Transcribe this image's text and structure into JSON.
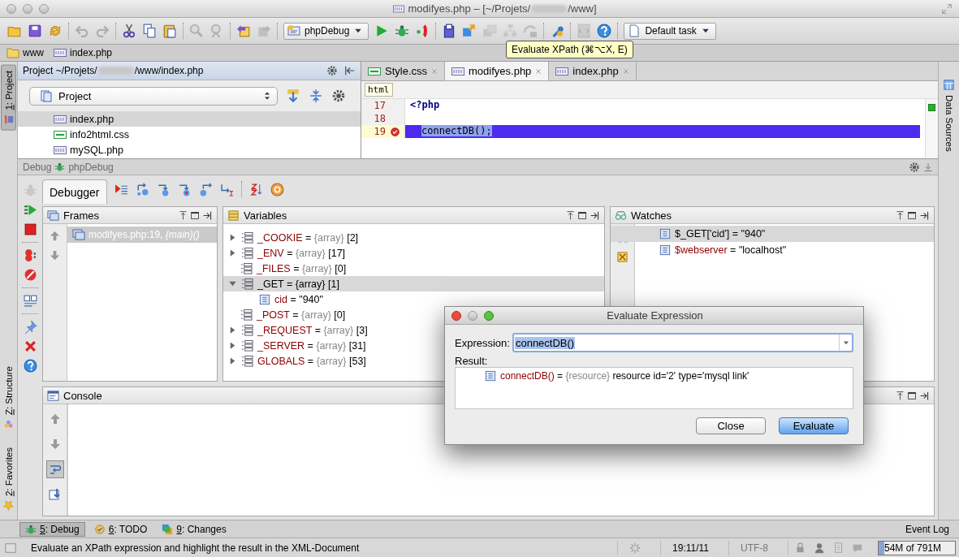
{
  "window": {
    "title_start": "modifyes.php – [~/Projets/",
    "title_end": "/www]"
  },
  "toolbar": {
    "groups": [
      {
        "items": [
          {
            "kind": "open",
            "disabled": false
          },
          {
            "kind": "save",
            "disabled": false
          },
          {
            "kind": "sync",
            "disabled": false
          }
        ]
      },
      {
        "items": [
          {
            "kind": "undo",
            "disabled": true
          },
          {
            "kind": "redo",
            "disabled": true
          }
        ]
      },
      {
        "items": [
          {
            "kind": "cut",
            "disabled": false
          },
          {
            "kind": "copy",
            "disabled": false
          },
          {
            "kind": "paste",
            "disabled": false
          }
        ]
      },
      {
        "items": [
          {
            "kind": "find",
            "disabled": true
          },
          {
            "kind": "replace",
            "disabled": true
          }
        ]
      },
      {
        "items": [
          {
            "kind": "back",
            "disabled": false
          },
          {
            "kind": "forward",
            "disabled": true
          }
        ]
      },
      {
        "items": [
          {
            "kind": "config",
            "label": "phpDebug",
            "disabled": false
          },
          {
            "kind": "run",
            "disabled": false
          },
          {
            "kind": "debug",
            "disabled": false
          },
          {
            "kind": "listen",
            "disabled": false
          }
        ]
      },
      {
        "items": [
          {
            "kind": "deploy",
            "disabled": false
          },
          {
            "kind": "upload",
            "disabled": false
          },
          {
            "kind": "layers",
            "disabled": true
          },
          {
            "kind": "tree",
            "disabled": true
          },
          {
            "kind": "rollback",
            "disabled": true
          }
        ]
      },
      {
        "items": [
          {
            "kind": "wrench",
            "disabled": false
          }
        ]
      },
      {
        "items": [
          {
            "kind": "xpath",
            "disabled": true
          },
          {
            "kind": "help",
            "disabled": false
          }
        ]
      },
      {
        "items": [
          {
            "kind": "task",
            "label": "Default task",
            "disabled": false
          }
        ]
      }
    ]
  },
  "tooltip": {
    "text": "Evaluate XPath (⌘⌥X, E)"
  },
  "breadcrumb": [
    {
      "label": "www",
      "kind": "folder"
    },
    {
      "label": "index.php",
      "kind": "php"
    }
  ],
  "left_stripe": [
    {
      "key": "1",
      "label": ": Project",
      "selected": true
    },
    {
      "key": "Z",
      "label": ": Structure",
      "selected": false
    },
    {
      "key": "2",
      "label": ": Favorites",
      "selected": false
    }
  ],
  "right_stripe": [
    {
      "label": "Data Sources",
      "selected": false
    }
  ],
  "project": {
    "header_start": "Project ~/Projets/",
    "header_end": "/www/index.php",
    "view": "Project",
    "files": [
      {
        "name": "index.php",
        "kind": "php",
        "selected": true
      },
      {
        "name": "info2html.css",
        "kind": "css",
        "selected": false
      },
      {
        "name": "mySQL.php",
        "kind": "php",
        "selected": false
      }
    ]
  },
  "editor": {
    "tabs": [
      {
        "label": "Style.css",
        "kind": "css",
        "selected": false
      },
      {
        "label": "modifyes.php",
        "kind": "php",
        "selected": true
      },
      {
        "label": "index.php",
        "kind": "php",
        "selected": false
      }
    ],
    "breadcrumb": "html",
    "lines": [
      {
        "number": "17",
        "code": "<?php",
        "kind": "keyword",
        "breakpoint": false,
        "current": false
      },
      {
        "number": "18",
        "kind": "plain",
        "breakpoint": false,
        "current": false
      },
      {
        "number": "19",
        "code": "connectDB();",
        "kind": "plain",
        "breakpoint": true,
        "current": true
      }
    ]
  },
  "debug": {
    "title": "Debug",
    "config": "phpDebug",
    "tabs": [
      {
        "label": "Debugger",
        "selected": true
      }
    ],
    "frames": {
      "title": "Frames",
      "items": [
        {
          "location": "modifyes.php:19, ",
          "function": "{main}()",
          "selected": true
        }
      ]
    },
    "variables": {
      "title": "Variables",
      "items": [
        {
          "name": "_COOKIE",
          "operator": "=",
          "type": "{array}",
          "value": "[2]",
          "kind": "node",
          "expanded": false,
          "selected": false
        },
        {
          "name": "_ENV",
          "operator": "=",
          "type": "{array}",
          "value": "[17]",
          "kind": "node",
          "expanded": false,
          "selected": false
        },
        {
          "name": "_FILES",
          "operator": "=",
          "type": "{array}",
          "value": "[0]",
          "kind": "empty",
          "expanded": false,
          "selected": false
        },
        {
          "name": "_GET",
          "operator": "=",
          "type": "{array}",
          "value": "[1]",
          "kind": "node",
          "expanded": true,
          "selected": true,
          "children": [
            {
              "name": "cid",
              "operator": "=",
              "value": "\"940\""
            }
          ]
        },
        {
          "name": "_POST",
          "operator": "=",
          "type": "{array}",
          "value": "[0]",
          "kind": "empty",
          "expanded": false,
          "selected": false
        },
        {
          "name": "_REQUEST",
          "operator": "=",
          "type": "{array}",
          "value": "[3]",
          "kind": "node",
          "expanded": false,
          "selected": false
        },
        {
          "name": "_SERVER",
          "operator": "=",
          "type": "{array}",
          "value": "[31]",
          "kind": "node",
          "expanded": false,
          "selected": false
        },
        {
          "name": "GLOBALS",
          "operator": "=",
          "type": "{array}",
          "value": "[53]",
          "kind": "node",
          "expanded": false,
          "selected": false
        }
      ]
    },
    "watches": {
      "title": "Watches",
      "items": [
        {
          "expression": "$_GET['cid']",
          "operator": "=",
          "value": "\"940\"",
          "selected": true
        },
        {
          "expression": "$webserver",
          "operator": "=",
          "value": "\"localhost\"",
          "selected": false
        }
      ]
    },
    "console": {
      "title": "Console",
      "tools": [
        {
          "kind": "up",
          "on": false
        },
        {
          "kind": "down",
          "on": false
        },
        {
          "kind": "wrap",
          "on": true
        },
        {
          "kind": "scroll-end",
          "on": false
        }
      ]
    }
  },
  "dialog": {
    "title": "Evaluate Expression",
    "expression_label": "Expression:",
    "expression": "connectDB()",
    "result_label": "Result:",
    "result": {
      "name": "connectDB()",
      "operator": "=",
      "type": "{resource}",
      "value": "resource id='2' type='mysql link'"
    },
    "buttons": [
      {
        "label": "Close",
        "default": false
      },
      {
        "label": "Evaluate",
        "default": true
      }
    ]
  },
  "bottom_tools": [
    {
      "key": "5",
      "label": ": Debug",
      "kind": "debug",
      "selected": true
    },
    {
      "key": "6",
      "label": ": TODO",
      "kind": "todo",
      "selected": false
    },
    {
      "key": "9",
      "label": ": Changes",
      "kind": "changes",
      "selected": false
    }
  ],
  "event_log": "Event Log",
  "status": {
    "message": "Evaluate an XPath expression and highlight the result in the XML-Document",
    "position": "19:11/11",
    "encoding": "UTF-8",
    "memory": {
      "text": "54M of 791M",
      "level": 0.07
    }
  }
}
